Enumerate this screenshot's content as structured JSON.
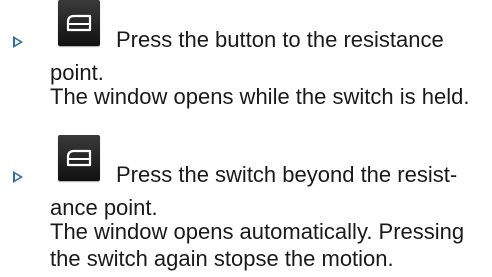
{
  "steps": [
    {
      "marker_icon": "triangle-bullet-icon",
      "switch_icon": "window-switch-icon",
      "instruction": "Press the button to the resistance point.",
      "result": "The window opens while the switch is held."
    },
    {
      "marker_icon": "triangle-bullet-icon",
      "switch_icon": "window-switch-icon",
      "instruction": "Press the switch beyond the resist-ance point.",
      "result": "The window opens automatically. Pressing the switch again stopse the motion."
    }
  ],
  "colors": {
    "marker": "#2f6db0",
    "icon_bg": "#1a1a1a",
    "icon_fg": "#ffffff",
    "text": "#1a1a1a"
  }
}
